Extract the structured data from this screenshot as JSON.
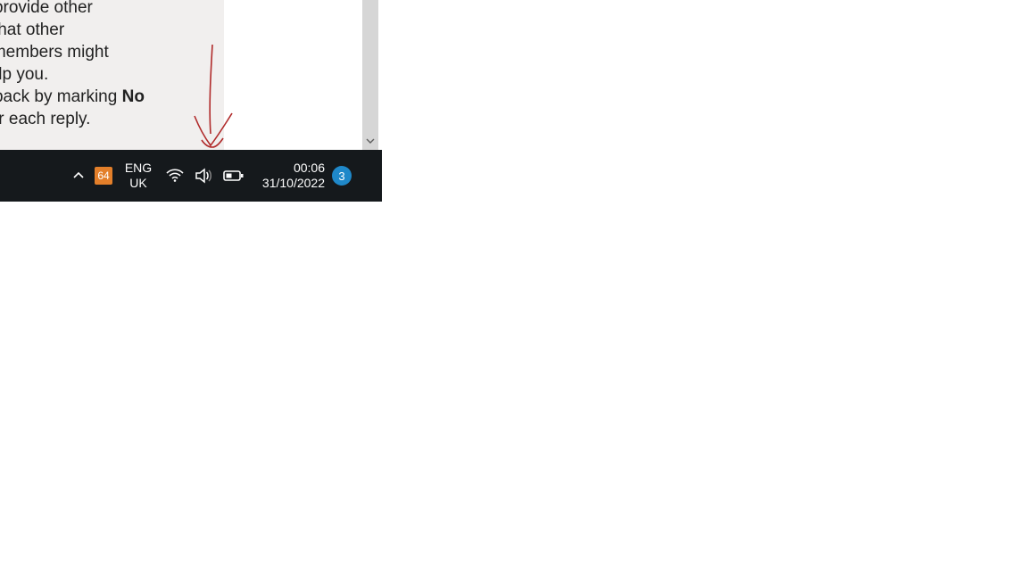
{
  "panel": {
    "line1": "s or provide other",
    "line2": "tion that other",
    "line3": "nity members might",
    "line4": "to help you.",
    "line5a": " feedback by marking ",
    "line5b_bold": "No",
    "line5c": " under each reply."
  },
  "taskbar": {
    "tray_badge": "64",
    "lang_top": "ENG",
    "lang_bottom": "UK",
    "time": "00:06",
    "date": "31/10/2022",
    "notif_count": "3"
  }
}
